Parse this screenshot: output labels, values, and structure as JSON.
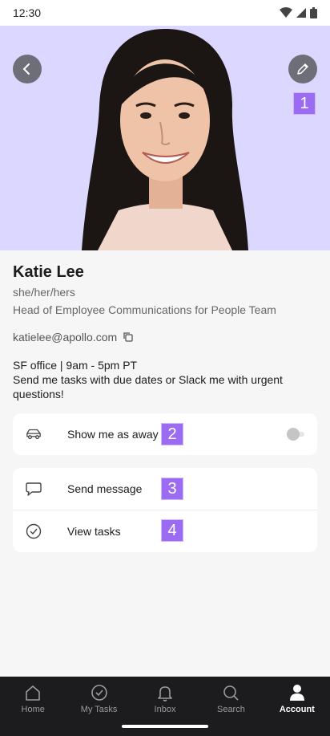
{
  "status_bar": {
    "time": "12:30"
  },
  "hero": {
    "background_color": "#dcd7ff",
    "back_icon": "chevron-left-icon",
    "edit_icon": "pencil-icon"
  },
  "profile": {
    "name": "Katie Lee",
    "pronouns": "she/her/hers",
    "role": "Head of Employee Communications for People Team",
    "email": "katielee@apollo.com",
    "copy_icon": "copy-icon",
    "status_line_1": "SF office | 9am - 5pm PT",
    "status_line_2": "Send me tasks with due dates or Slack me with urgent questions!"
  },
  "away_card": {
    "label": "Show me as away",
    "icon": "car-icon",
    "toggle_on": false
  },
  "actions": {
    "send_message": {
      "label": "Send message",
      "icon": "chat-bubble-icon"
    },
    "view_tasks": {
      "label": "View tasks",
      "icon": "check-circle-icon"
    }
  },
  "badges": [
    "1",
    "2",
    "3",
    "4"
  ],
  "tab_bar": {
    "tabs": [
      {
        "label": "Home",
        "icon": "home-icon",
        "active": false
      },
      {
        "label": "My Tasks",
        "icon": "check-circle-icon",
        "active": false
      },
      {
        "label": "Inbox",
        "icon": "bell-icon",
        "active": false
      },
      {
        "label": "Search",
        "icon": "search-icon",
        "active": false
      },
      {
        "label": "Account",
        "icon": "person-icon",
        "active": true
      }
    ]
  },
  "colors": {
    "accent_badge": "#9b6cf2",
    "tab_bar_bg": "#1c1c1e"
  }
}
